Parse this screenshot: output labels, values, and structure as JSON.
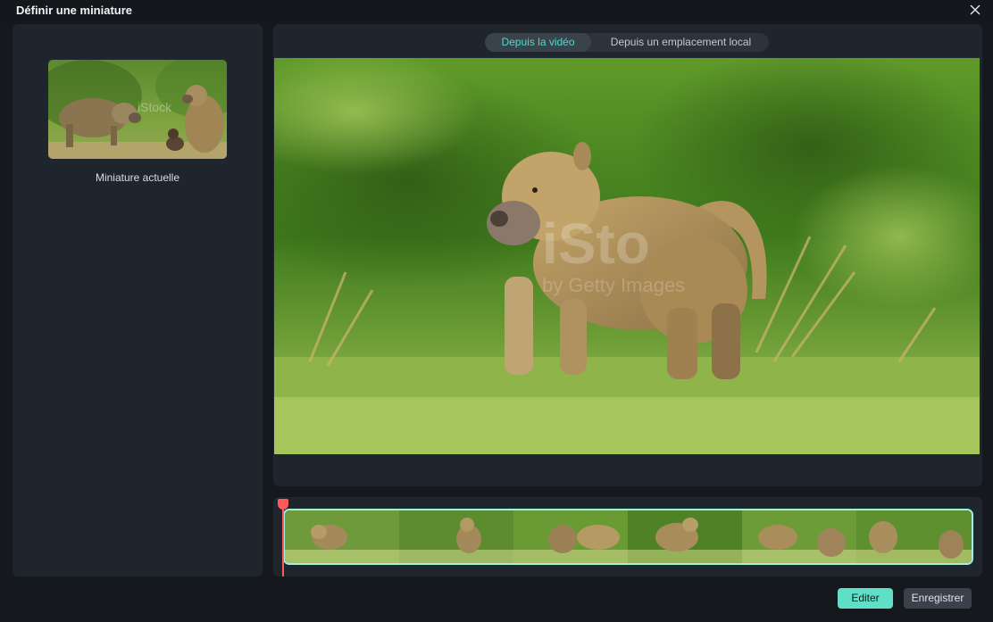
{
  "dialog": {
    "title": "Définir une miniature"
  },
  "current_thumbnail": {
    "label": "Miniature actuelle"
  },
  "tabs": [
    {
      "label": "Depuis la vidéo",
      "active": true
    },
    {
      "label": "Depuis un emplacement local",
      "active": false
    }
  ],
  "preview": {
    "watermark": "iStock by Getty Images"
  },
  "actions": {
    "edit_label": "Editer",
    "save_label": "Enregistrer"
  },
  "colors": {
    "accent": "#5fe0c6",
    "playhead": "#ff5a5a",
    "panel": "#1f252c"
  },
  "icons": {
    "close": "close-icon",
    "playhead": "playhead-marker"
  }
}
